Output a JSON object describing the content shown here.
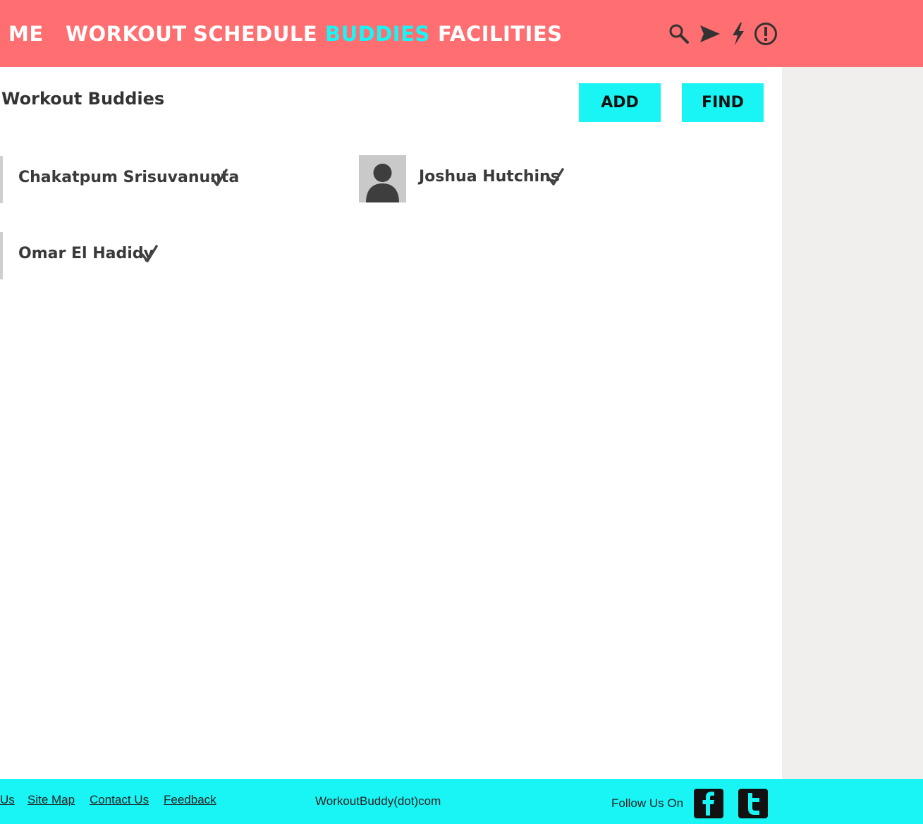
{
  "nav": {
    "items": [
      {
        "label": "ME",
        "active": false
      },
      {
        "label": "WORKOUT",
        "active": false
      },
      {
        "label": "SCHEDULE",
        "active": false
      },
      {
        "label": "BUDDIES",
        "active": true
      },
      {
        "label": "FACILITIES",
        "active": false
      }
    ],
    "icons": [
      "search-icon",
      "send-icon",
      "lightning-icon",
      "alert-icon"
    ]
  },
  "main": {
    "title": "Workout Buddies",
    "add_label": "ADD",
    "find_label": "FIND",
    "buddies": [
      {
        "name": "Chakatpum Srisuvanunta",
        "has_avatar": false
      },
      {
        "name": "Joshua Hutchins",
        "has_avatar": true
      },
      {
        "name": "Omar El Hadidy",
        "has_avatar": false
      }
    ]
  },
  "footer": {
    "links": [
      "Us",
      "Site Map",
      "Contact Us",
      "Feedback"
    ],
    "site_name": "WorkoutBuddy(dot)com",
    "follow_label": "Follow Us On",
    "social_icons": [
      "facebook-icon",
      "twitter-icon"
    ]
  },
  "colors": {
    "header_bg": "#ff6e70",
    "accent": "#19f5f5",
    "sidebar_bg": "#f1efed"
  }
}
